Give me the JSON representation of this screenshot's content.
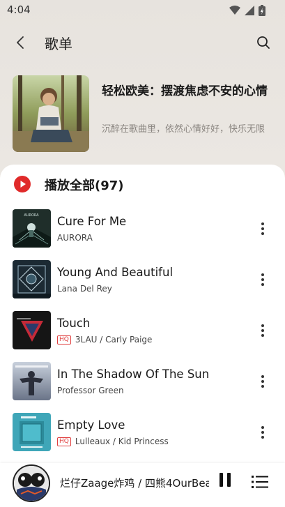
{
  "status": {
    "time": "4:04"
  },
  "header": {
    "title": "歌单"
  },
  "playlist": {
    "title": "轻松欧美：摆渡焦虑不安的心情",
    "description": "沉醉在歌曲里，依然心情好好，快乐无限"
  },
  "play_all": {
    "label": "播放全部(97)"
  },
  "songs": [
    {
      "title": "Cure For Me",
      "artist": "AURORA",
      "hq": false,
      "hq_label": ""
    },
    {
      "title": "Young And Beautiful",
      "artist": "Lana Del Rey",
      "hq": false,
      "hq_label": ""
    },
    {
      "title": "Touch",
      "artist": "3LAU / Carly Paige",
      "hq": true,
      "hq_label": "HQ"
    },
    {
      "title": "In The Shadow Of The Sun",
      "artist": "Professor Green",
      "hq": false,
      "hq_label": ""
    },
    {
      "title": "Empty Love",
      "artist": "Lulleaux / Kid Princess",
      "hq": true,
      "hq_label": "HQ"
    }
  ],
  "mini_player": {
    "title": "烂仔Zaage炸鸡 / 四熊4OurBea"
  },
  "colors": {
    "accent": "#e02a2a",
    "hq": "#e04040"
  }
}
